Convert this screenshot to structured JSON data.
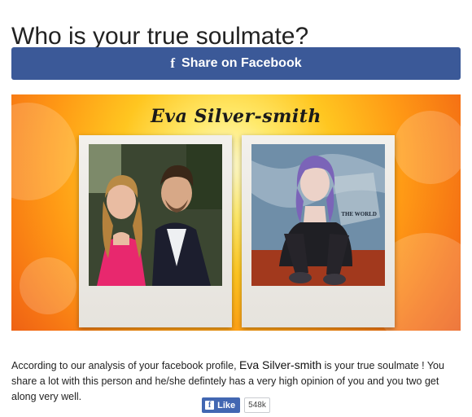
{
  "page": {
    "title": "Who is your true soulmate?"
  },
  "share": {
    "icon": "facebook-f-icon",
    "icon_glyph": "f",
    "label": "Share on Facebook",
    "color": "#3b5998"
  },
  "result": {
    "name": "Eva Silver-smith",
    "description_before": "According to our analysis of your facebook profile, ",
    "description_name": "Eva Silver-smith",
    "description_after": " is your true soulmate ! You share a lot with this person and he/she defintely has a very high opinion of you and you two get along very well.",
    "photo_right_text": "THE WORLD"
  },
  "like": {
    "icon": "facebook-f-icon",
    "icon_glyph": "f",
    "label": "Like",
    "count": "548k",
    "color": "#4267b2"
  }
}
